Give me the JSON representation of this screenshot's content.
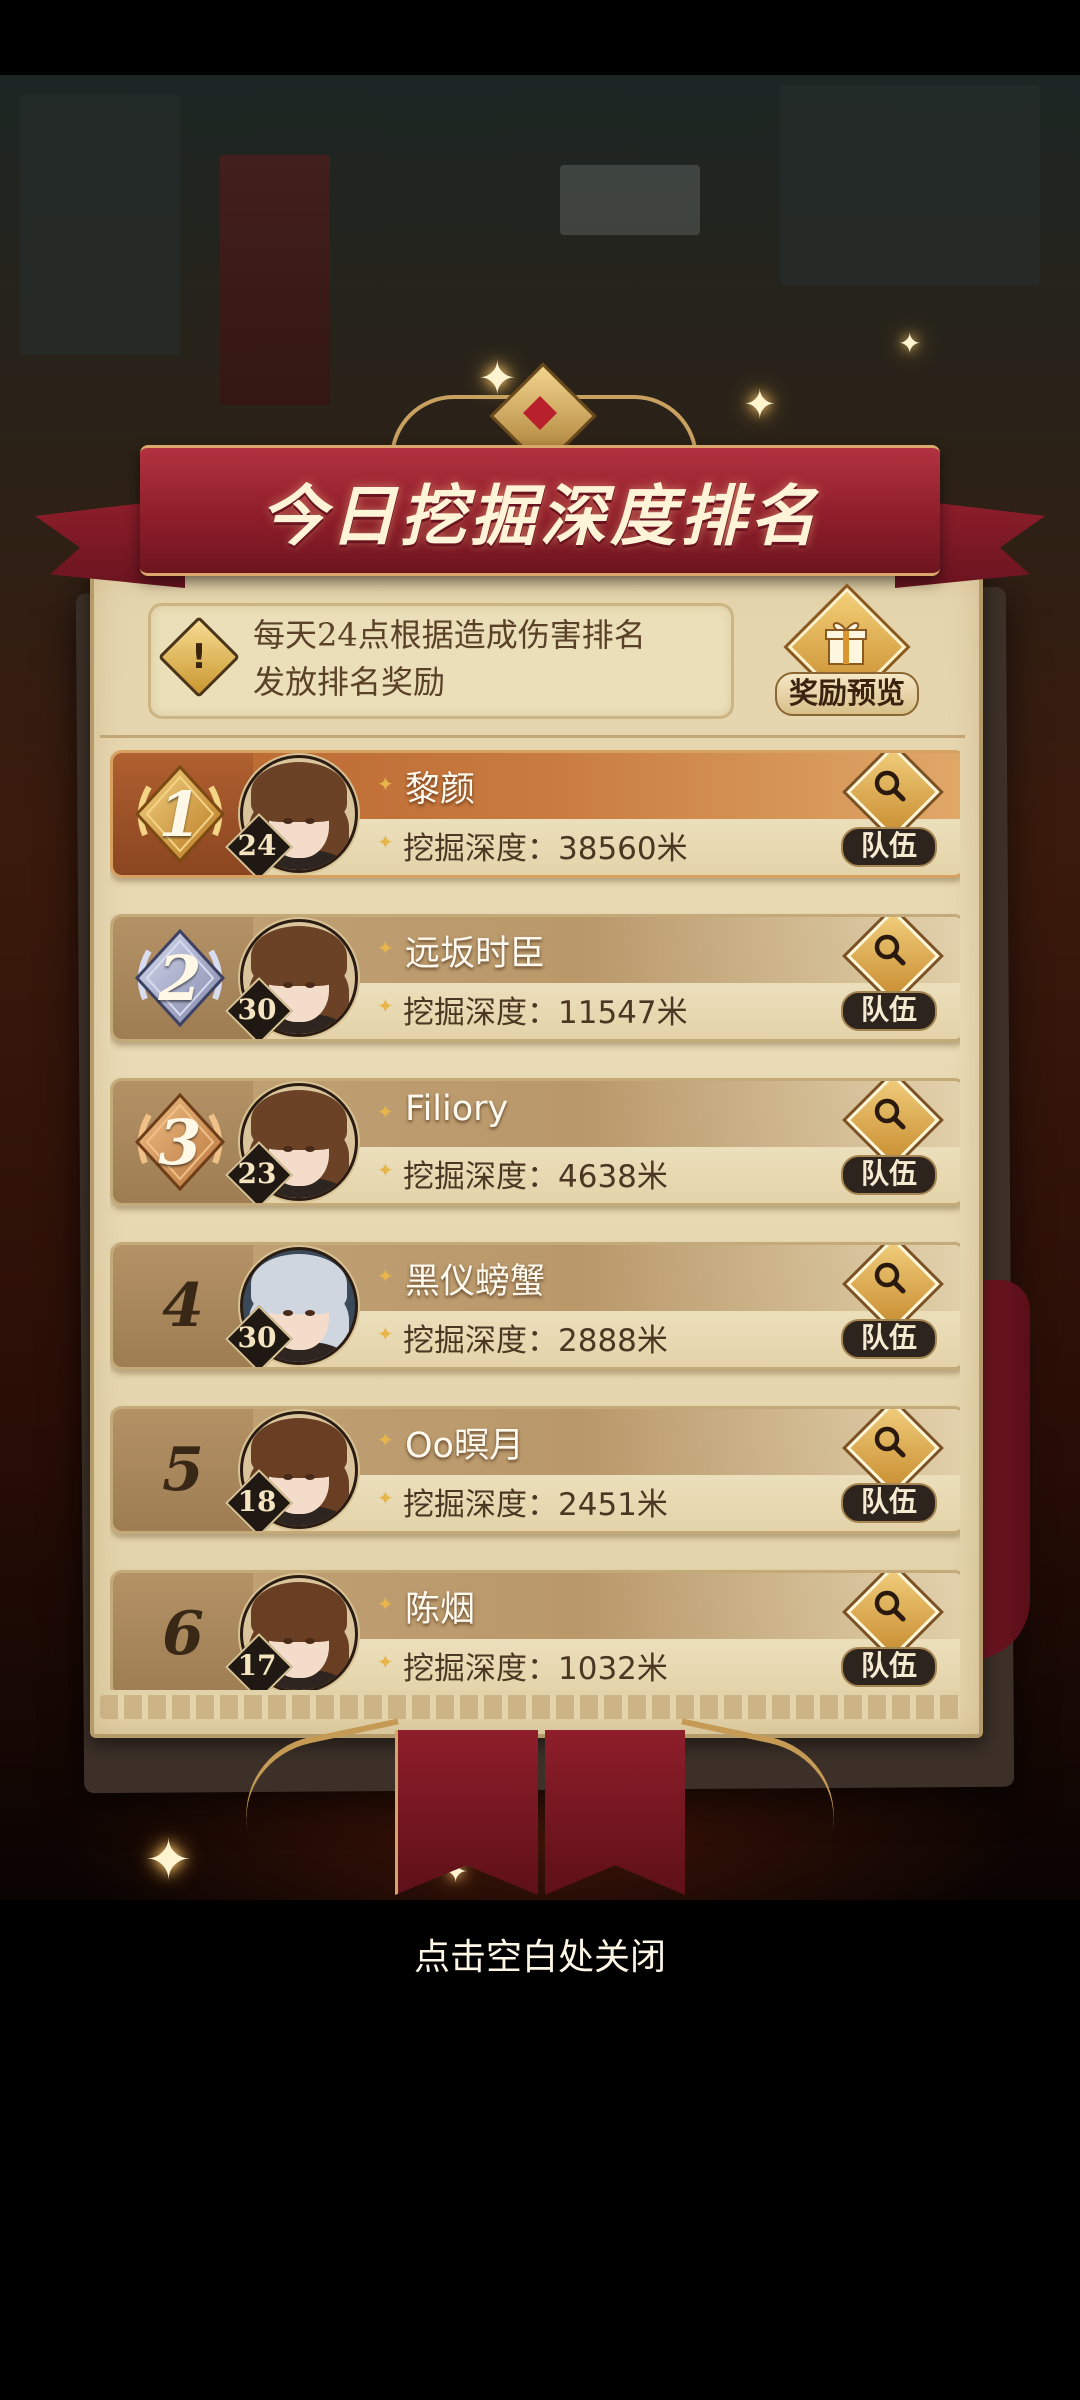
{
  "title": "今日挖掘深度排名",
  "info": {
    "line1": "每天24点根据造成伤害排名",
    "line2": "发放排名奖励"
  },
  "reward_button": {
    "label": "奖励预览",
    "icon": "gift-icon"
  },
  "depth_prefix": "挖掘深度：",
  "team_label": "队伍",
  "rankings": [
    {
      "rank": "1",
      "name": "黎颜",
      "level": "24",
      "depth": "挖掘深度：38560米",
      "medal": "gold"
    },
    {
      "rank": "2",
      "name": "远坂时臣",
      "level": "30",
      "depth": "挖掘深度：11547米",
      "medal": "silver"
    },
    {
      "rank": "3",
      "name": "Filiory",
      "level": "23",
      "depth": "挖掘深度：4638米",
      "medal": "bronze"
    },
    {
      "rank": "4",
      "name": "黑仪螃蟹",
      "level": "30",
      "depth": "挖掘深度：2888米"
    },
    {
      "rank": "5",
      "name": "Oo暝月",
      "level": "18",
      "depth": "挖掘深度：2451米"
    },
    {
      "rank": "6",
      "name": "陈烟",
      "level": "17",
      "depth": "挖掘深度：1032米"
    }
  ],
  "close_hint": "点击空白处关闭",
  "colors": {
    "gold": "#c98a2a",
    "silver": "#7f86a8",
    "bronze": "#b8743a",
    "ribbon": "#8e1e2a",
    "parchment": "#e9dbb6"
  }
}
